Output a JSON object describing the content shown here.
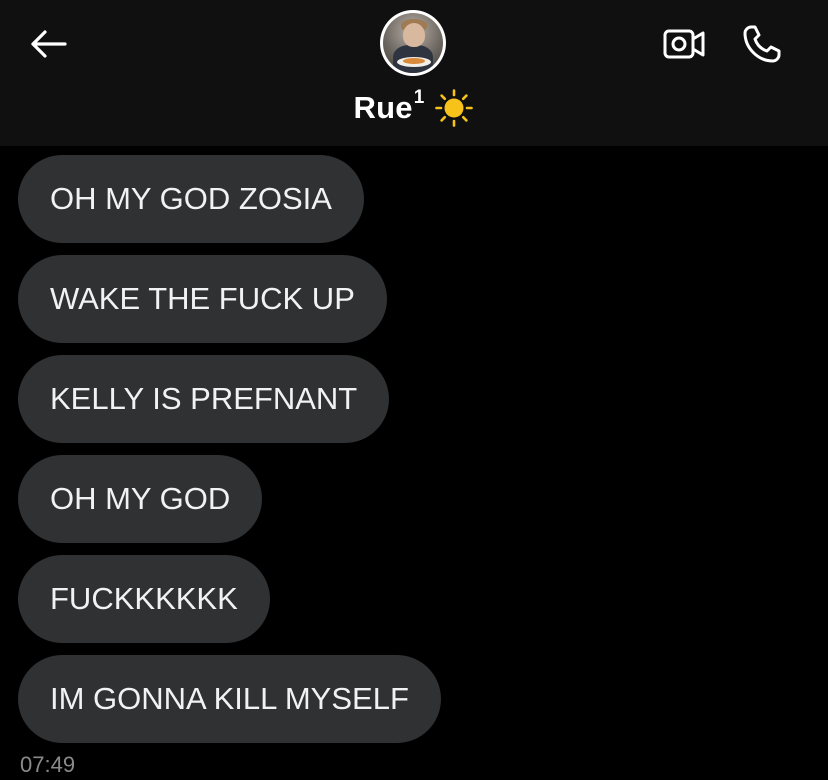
{
  "header": {
    "contact_name": "Rue",
    "streak_number": "1",
    "status_emoji": "☀️",
    "icons": {
      "back": "arrow-left-icon",
      "video": "video-camera-icon",
      "call": "phone-icon",
      "status": "sun-icon"
    }
  },
  "messages": [
    {
      "text": "OH MY GOD ZOSIA"
    },
    {
      "text": "WAKE THE FUCK UP"
    },
    {
      "text": "KELLY IS PREFNANT"
    },
    {
      "text": "OH MY GOD"
    },
    {
      "text": "FUCKKKKKK"
    },
    {
      "text": "IM GONNA KILL MYSELF"
    }
  ],
  "timestamp": "07:49",
  "colors": {
    "background": "#000000",
    "header_background": "#101010",
    "bubble": "#2f3133",
    "bubble_text": "#f2f2f2",
    "timestamp_text": "#8a8a8a",
    "sun": "#f7c21a"
  }
}
